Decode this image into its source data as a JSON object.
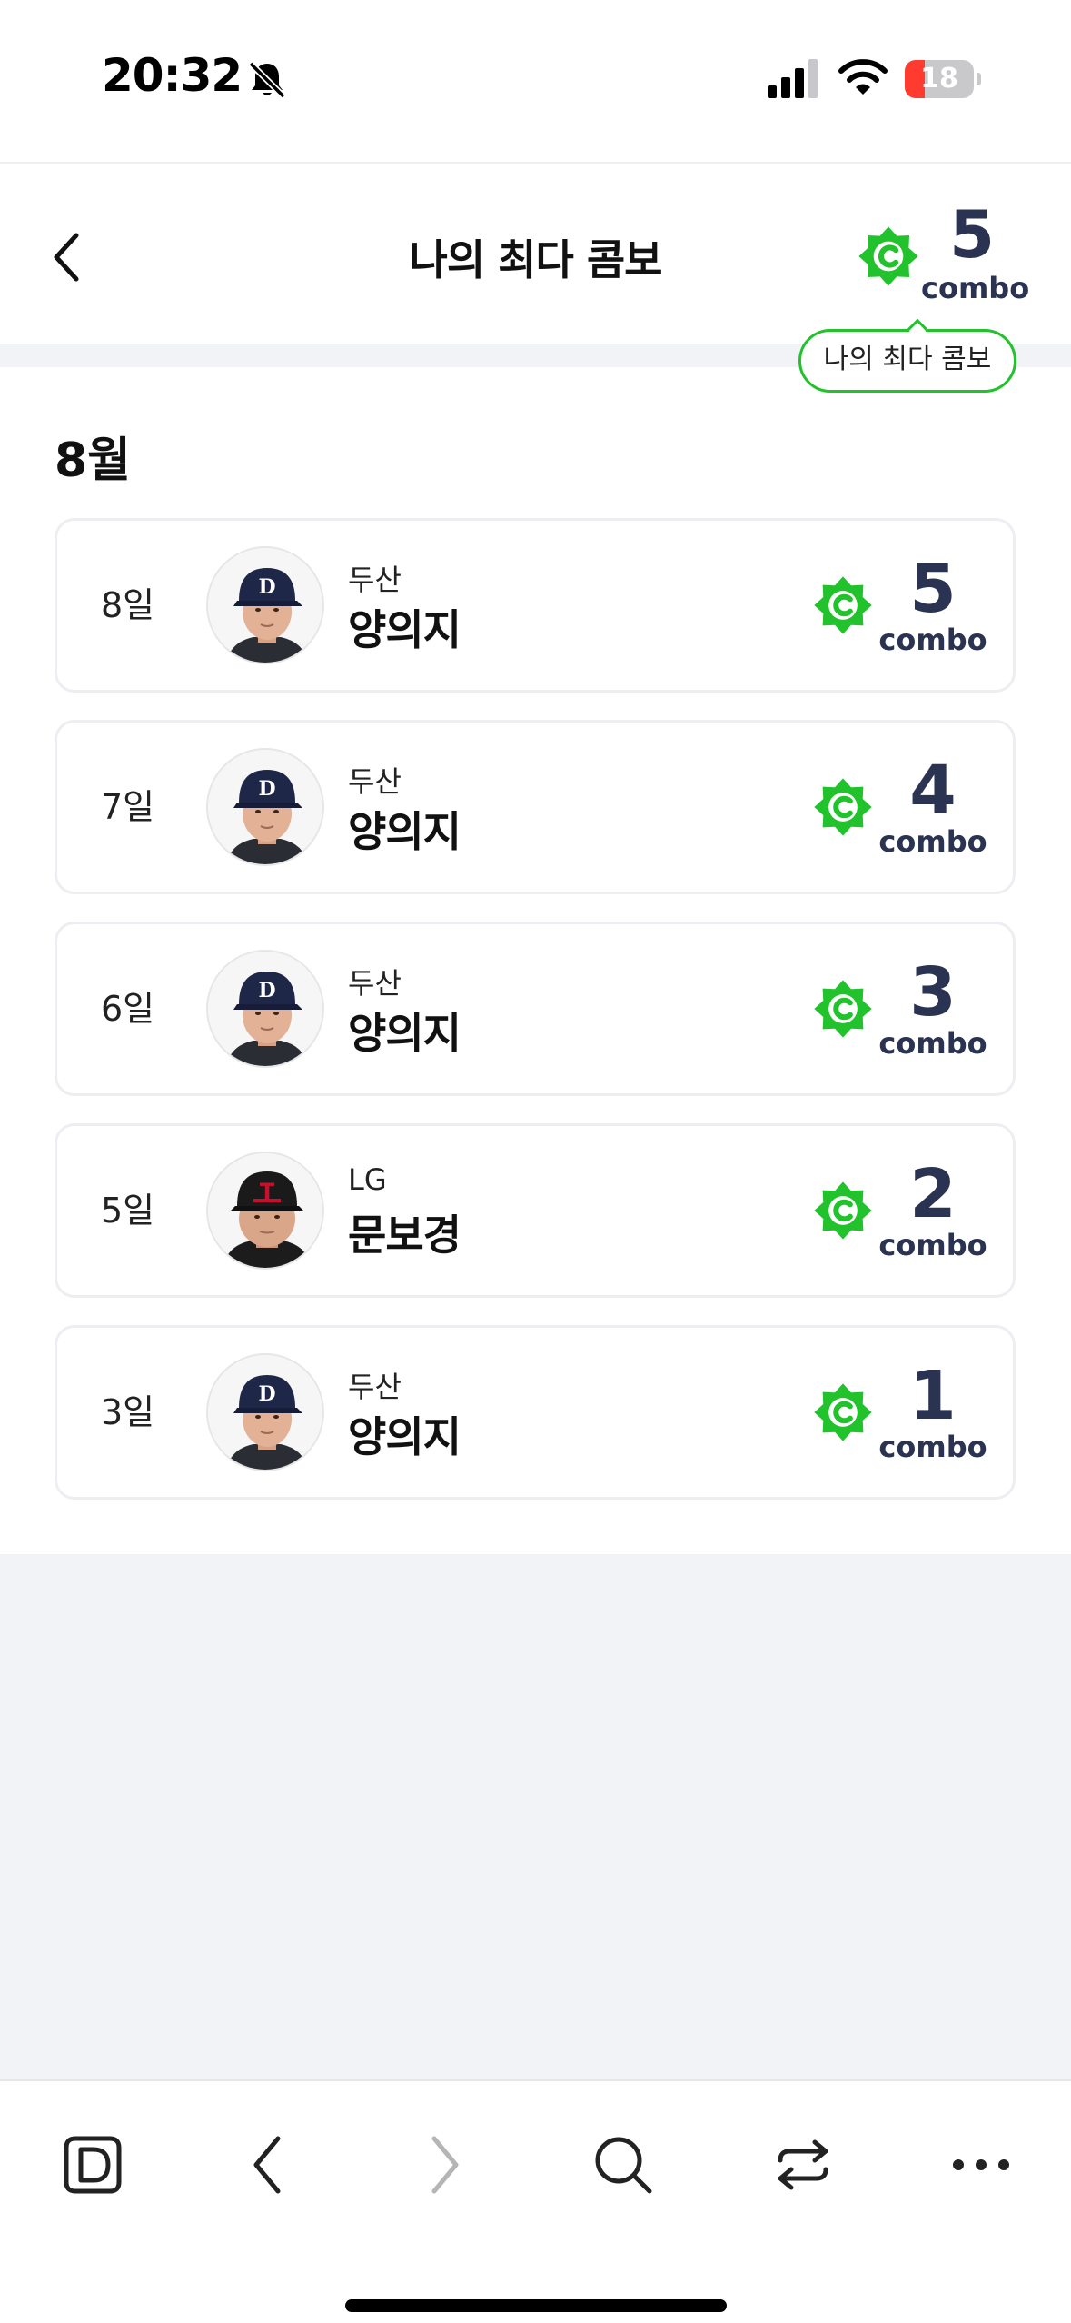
{
  "status_bar": {
    "time": "20:32",
    "battery_level": "18",
    "battery_fraction": 0.18
  },
  "header": {
    "title": "나의 최다 콤보",
    "max_combo_value": "5",
    "combo_unit": "combo",
    "tooltip": "나의 최다 콤보"
  },
  "month_title": "8월",
  "entries": [
    {
      "day": "8일",
      "team": "두산",
      "player": "양의지",
      "combo_value": "5",
      "combo_unit": "combo"
    },
    {
      "day": "7일",
      "team": "두산",
      "player": "양의지",
      "combo_value": "4",
      "combo_unit": "combo"
    },
    {
      "day": "6일",
      "team": "두산",
      "player": "양의지",
      "combo_value": "3",
      "combo_unit": "combo"
    },
    {
      "day": "5일",
      "team": "LG",
      "player": "문보경",
      "combo_value": "2",
      "combo_unit": "combo"
    },
    {
      "day": "3일",
      "team": "두산",
      "player": "양의지",
      "combo_value": "1",
      "combo_unit": "combo"
    }
  ],
  "colors": {
    "accent_green": "#21c22b",
    "combo_navy": "#2a3351",
    "doosan_cap": "#1f2748",
    "lg_cap": "#1a1a1a",
    "lg_letter": "#c8102e"
  },
  "icons": {
    "back": "chevron-left-icon",
    "badge": "combo-badge-icon",
    "toolbar": [
      "d-logo-icon",
      "back-arrow-icon",
      "forward-arrow-icon",
      "search-icon",
      "share-icon",
      "more-icon"
    ]
  }
}
